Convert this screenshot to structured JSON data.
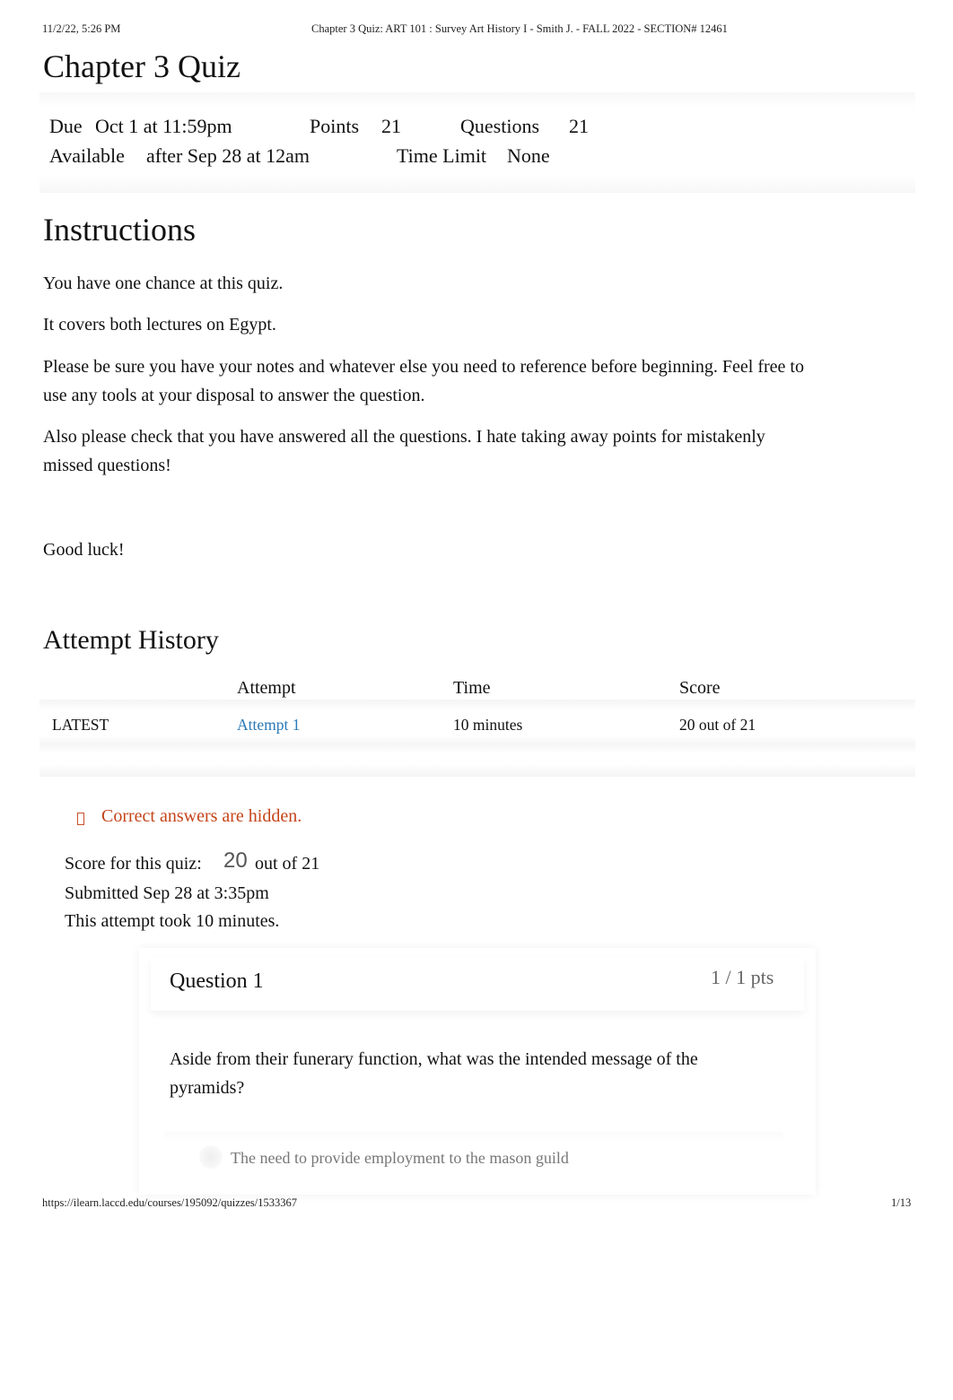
{
  "print_header": {
    "datetime": "11/2/22, 5:26 PM",
    "title": "Chapter 3 Quiz: ART 101 : Survey Art History I - Smith J. - FALL 2022 - SECTION# 12461"
  },
  "print_footer": {
    "url": "https://ilearn.laccd.edu/courses/195092/quizzes/1533367",
    "page": "1/13"
  },
  "quiz": {
    "title": "Chapter 3 Quiz",
    "meta": {
      "due_label": "Due",
      "due_value": "Oct 1 at 11:59pm",
      "points_label": "Points",
      "points_value": "21",
      "questions_label": "Questions",
      "questions_value": "21",
      "available_label": "Available",
      "available_value": "after Sep 28 at 12am",
      "time_limit_label": "Time Limit",
      "time_limit_value": "None"
    }
  },
  "instructions": {
    "heading": "Instructions",
    "paragraphs": [
      "You have one chance at this quiz.",
      "It covers both lectures on Egypt.",
      "Please be sure you have your notes and whatever else you need to reference before beginning. Feel free to use any tools at your disposal to answer the question.",
      "Also please check that you have answered all the questions. I hate taking away points for mistakenly missed questions!",
      "Good luck!"
    ]
  },
  "attempt_history": {
    "heading": "Attempt History",
    "columns": [
      "",
      "Attempt",
      "Time",
      "Score"
    ],
    "rows": [
      {
        "tag": "LATEST",
        "attempt": "Attempt 1",
        "time": "10 minutes",
        "score": "20 out of 21"
      }
    ]
  },
  "result": {
    "notice_icon": "warning-icon",
    "notice": "Correct answers are hidden.",
    "score_label": "Score for this quiz:",
    "score_value": "20",
    "score_total": "out of 21",
    "submitted": "Submitted Sep 28 at 3:35pm",
    "duration": "This attempt took 10 minutes."
  },
  "questions": [
    {
      "title": "Question 1",
      "points": "1 / 1 pts",
      "text": "Aside from their funerary function, what was the intended message of the pyramids?",
      "answers": [
        "The need to provide employment to the mason guild"
      ]
    }
  ],
  "colors": {
    "link": "#2a7ab8",
    "notice": "#c4441a",
    "muted": "#777777"
  }
}
